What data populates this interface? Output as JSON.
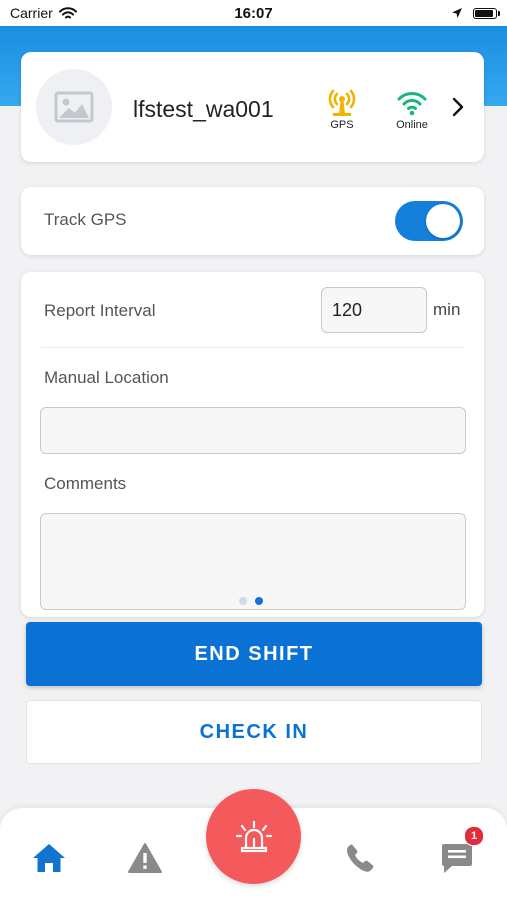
{
  "status_bar": {
    "carrier": "Carrier",
    "time": "16:07",
    "battery_level": 0.9
  },
  "profile": {
    "username": "lfstest_wa001",
    "gps_label": "GPS",
    "online_label": "Online"
  },
  "track_gps": {
    "label": "Track GPS",
    "enabled": true
  },
  "form": {
    "report_interval_label": "Report Interval",
    "report_interval_value": "120",
    "report_interval_unit": "min",
    "manual_location_label": "Manual Location",
    "manual_location_value": "",
    "comments_label": "Comments",
    "comments_value": "",
    "page_index": 2,
    "page_count": 2
  },
  "buttons": {
    "end_shift": "END SHIFT",
    "check_in": "CHECK IN"
  },
  "tab_bar": {
    "chat_badge": "1"
  },
  "colors": {
    "accent": "#0a72d4",
    "header": "#1a8fe0",
    "sos": "#f4595c",
    "gps_icon": "#f0b400",
    "online_icon": "#15b87a",
    "badge": "#e12c3a"
  },
  "icons": {
    "gps": "gps-tower-icon",
    "online": "wifi-icon",
    "sos": "siren-icon",
    "home": "home-icon",
    "alert": "warning-icon",
    "phone": "phone-icon",
    "chat": "chat-icon"
  }
}
